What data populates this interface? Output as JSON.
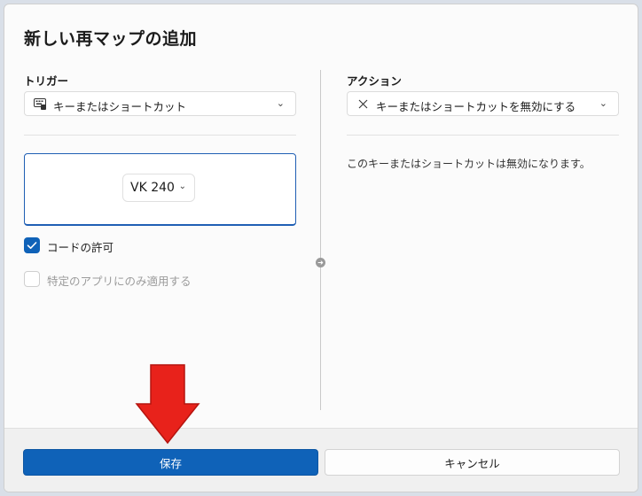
{
  "dialog": {
    "title": "新しい再マップの追加"
  },
  "trigger": {
    "label": "トリガー",
    "type_value": "キーまたはショートカット",
    "key_value": "VK 240",
    "chord_label": "コードの許可",
    "chord_checked": true,
    "app_specific_label": "特定のアプリにのみ適用する",
    "app_specific_checked": false
  },
  "action": {
    "label": "アクション",
    "type_value": "キーまたはショートカットを無効にする",
    "description": "このキーまたはショートカットは無効になります。"
  },
  "footer": {
    "save_label": "保存",
    "cancel_label": "キャンセル"
  },
  "colors": {
    "accent": "#0f62b8",
    "annotation_arrow": "#e8221b"
  }
}
